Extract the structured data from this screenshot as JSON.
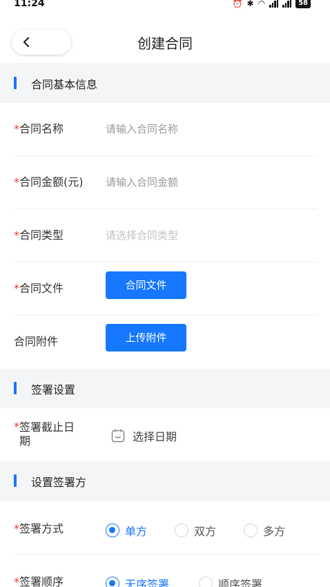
{
  "status_bar": {
    "time": "11:24",
    "battery": "58"
  },
  "header": {
    "title": "创建合同"
  },
  "sections": {
    "basic": "合同基本信息",
    "signing": "签署设置",
    "parties": "设置签署方"
  },
  "fields": {
    "required_mark": "*",
    "name": {
      "label": "合同名称",
      "placeholder": "请输入合同名称"
    },
    "amount": {
      "label": "合同金额(元)",
      "placeholder": "请输入合同金额"
    },
    "type": {
      "label": "合同类型",
      "placeholder": "请选择合同类型"
    },
    "file": {
      "label": "合同文件",
      "button": "合同文件"
    },
    "attachment": {
      "label": "合同附件",
      "button": "上传附件"
    },
    "deadline": {
      "label_line1": "签署截止日",
      "label_line2": "期",
      "picker": "选择日期"
    },
    "sign_method": {
      "label": "签署方式",
      "options": [
        "单方",
        "双方",
        "多方"
      ],
      "selected": "单方"
    },
    "sign_order": {
      "label": "签署顺序",
      "options": [
        "无序签署",
        "顺序签署"
      ],
      "selected": "无序签署"
    }
  },
  "colors": {
    "accent": "#1677ff",
    "required": "#ee3333",
    "section_bg": "#f4f5f7"
  }
}
